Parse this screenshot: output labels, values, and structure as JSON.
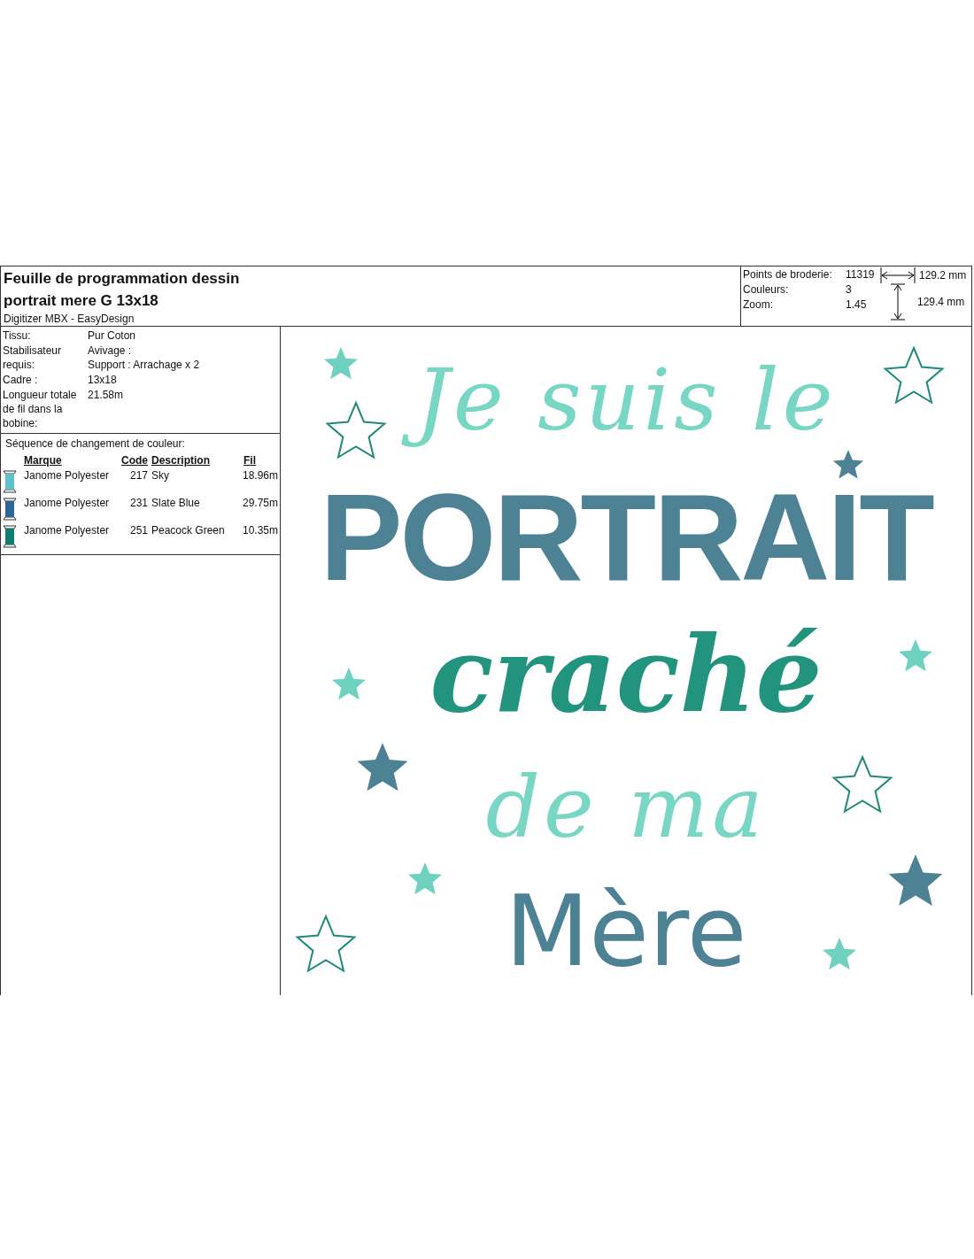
{
  "header": {
    "title_lines": [
      "Feuille de programmation dessin",
      "portrait mere G 13x18"
    ],
    "subtitle": "Digitizer MBX - EasyDesign"
  },
  "summary": {
    "rows": [
      {
        "label": "Points de broderie:",
        "value": "11319"
      },
      {
        "label": "Couleurs:",
        "value": "3"
      },
      {
        "label": "Zoom:",
        "value": "1.45"
      }
    ],
    "width": "129.2 mm",
    "height": "129.4 mm"
  },
  "details": [
    {
      "label": "Tissu:",
      "values": [
        "Pur Coton"
      ]
    },
    {
      "label": "Stabilisateur requis:",
      "values": [
        "Avivage :",
        "Support : Arrachage x 2"
      ]
    },
    {
      "label": "Cadre :",
      "values": [
        "13x18"
      ]
    },
    {
      "label": "Longueur totale de fil dans la bobine:",
      "values": [
        "21.58m"
      ]
    }
  ],
  "color_sequence": {
    "title": "Séquence de changement de couleur:",
    "columns": [
      "Marque",
      "Code",
      "Description",
      "Fil"
    ],
    "rows": [
      {
        "color": "#5cc3c9",
        "brand": "Janome Polyester",
        "code": "217",
        "description": "Sky",
        "length": "18.96m"
      },
      {
        "color": "#2f6496",
        "brand": "Janome Polyester",
        "code": "231",
        "description": "Slate Blue",
        "length": "29.75m"
      },
      {
        "color": "#0f7d70",
        "brand": "Janome Polyester",
        "code": "251",
        "description": "Peacock Green",
        "length": "10.35m"
      }
    ]
  },
  "design": {
    "lines": [
      {
        "text": "Je suis le",
        "kind": "swirl",
        "color": "#78d6c4"
      },
      {
        "text": "PORTRAIT",
        "kind": "block",
        "color": "#4c8294"
      },
      {
        "text": "craché",
        "kind": "script",
        "color": "#22937d"
      },
      {
        "text": "de ma",
        "kind": "swirl",
        "color": "#78d6c4"
      },
      {
        "text": "Mère",
        "kind": "rounded",
        "color": "#4c8294"
      }
    ]
  }
}
